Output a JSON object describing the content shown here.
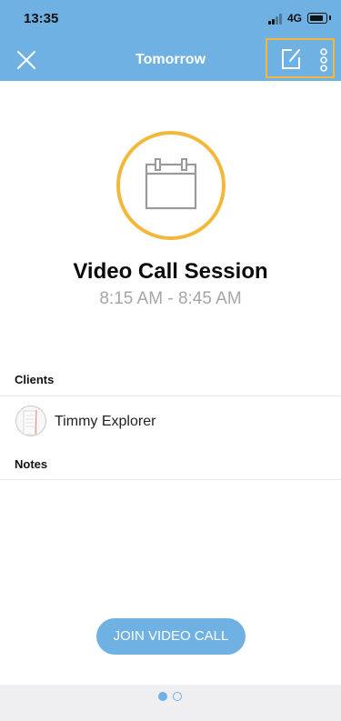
{
  "status_bar": {
    "time": "13:35",
    "network": "4G"
  },
  "nav": {
    "title": "Tomorrow",
    "close_icon": "close-icon",
    "edit_icon": "edit-icon",
    "more_icon": "more-vertical-icon",
    "highlight_color": "#f2b83a"
  },
  "event": {
    "icon": "calendar-icon",
    "title": "Video Call Session",
    "time": "8:15 AM - 8:45 AM"
  },
  "clients": {
    "label": "Clients",
    "items": [
      {
        "name": "Timmy Explorer"
      }
    ]
  },
  "notes": {
    "label": "Notes"
  },
  "actions": {
    "join_label": "JOIN VIDEO CALL"
  },
  "pager": {
    "current": 1,
    "total": 2
  },
  "colors": {
    "header": "#6fb1e2",
    "accent": "#f2b83a",
    "button": "#6fb1e2",
    "footer": "#efeff1"
  }
}
